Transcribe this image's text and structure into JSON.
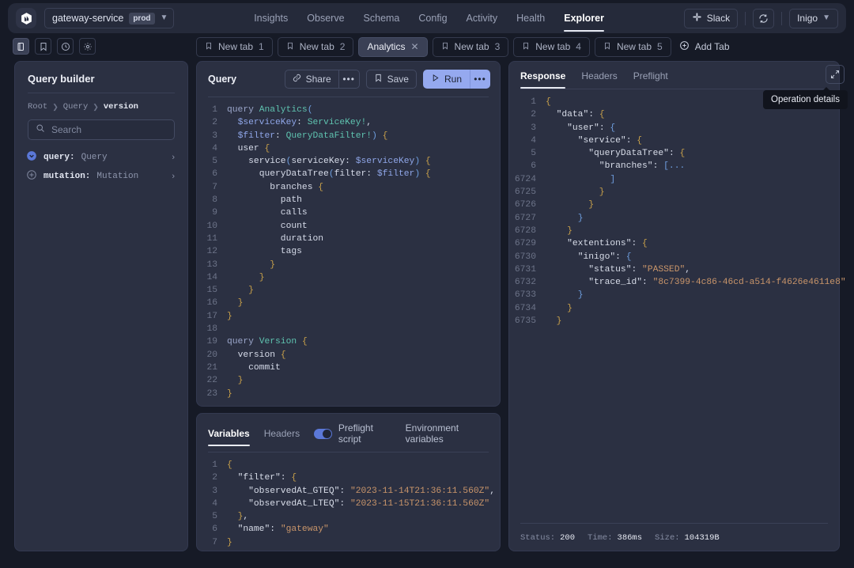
{
  "header": {
    "service_name": "gateway-service",
    "env_badge": "prod",
    "nav": [
      {
        "label": "Insights",
        "active": false
      },
      {
        "label": "Observe",
        "active": false
      },
      {
        "label": "Schema",
        "active": false
      },
      {
        "label": "Config",
        "active": false
      },
      {
        "label": "Activity",
        "active": false
      },
      {
        "label": "Health",
        "active": false
      },
      {
        "label": "Explorer",
        "active": true
      }
    ],
    "slack_label": "Slack",
    "refresh_icon": "refresh-icon",
    "user_menu": "Inigo"
  },
  "rail": [
    {
      "icon": "docs-icon",
      "active": true
    },
    {
      "icon": "bookmark-icon",
      "active": false
    },
    {
      "icon": "history-clock-icon",
      "active": false
    },
    {
      "icon": "gear-icon",
      "active": false
    }
  ],
  "tabs": {
    "items": [
      {
        "label": "New tab",
        "num": "1",
        "active": false,
        "closable": false
      },
      {
        "label": "New tab",
        "num": "2",
        "active": false,
        "closable": false
      },
      {
        "label": "Analytics",
        "num": "",
        "active": true,
        "closable": true
      },
      {
        "label": "New tab",
        "num": "3",
        "active": false,
        "closable": false
      },
      {
        "label": "New tab",
        "num": "4",
        "active": false,
        "closable": false
      },
      {
        "label": "New tab",
        "num": "5",
        "active": false,
        "closable": false
      }
    ],
    "add_label": "Add Tab"
  },
  "query_builder": {
    "title": "Query builder",
    "breadcrumb": [
      "Root",
      "Query",
      "version"
    ],
    "search_placeholder": "Search",
    "search_value": "",
    "tree": [
      {
        "name": "query:",
        "type": "Query",
        "expanded": true
      },
      {
        "name": "mutation:",
        "type": "Mutation",
        "expanded": false
      }
    ]
  },
  "query_editor": {
    "title": "Query",
    "share_label": "Share",
    "save_label": "Save",
    "run_label": "Run",
    "more_label": "•••",
    "lines": [
      {
        "n": "1",
        "html": "<span class='k-kw'>query</span> <span class='k-type'>Analytics</span><span class='k-paren'>(</span>"
      },
      {
        "n": "2",
        "html": "  <span class='k-var'>$serviceKey</span><span class='k-field'>:</span> <span class='k-type'>ServiceKey!</span><span class='k-field'>,</span>"
      },
      {
        "n": "3",
        "html": "  <span class='k-var'>$filter</span><span class='k-field'>:</span> <span class='k-type'>QueryDataFilter!</span><span class='k-paren'>)</span> <span class='k-punc'>{</span>"
      },
      {
        "n": "4",
        "html": "  <span class='k-field'>user</span> <span class='k-punc'>{</span>"
      },
      {
        "n": "5",
        "html": "    <span class='k-field'>service</span><span class='k-paren'>(</span><span class='k-field'>serviceKey:</span> <span class='k-var'>$serviceKey</span><span class='k-paren'>)</span> <span class='k-punc'>{</span>"
      },
      {
        "n": "6",
        "html": "      <span class='k-field'>queryDataTree</span><span class='k-paren'>(</span><span class='k-field'>filter:</span> <span class='k-var'>$filter</span><span class='k-paren'>)</span> <span class='k-punc'>{</span>"
      },
      {
        "n": "7",
        "html": "        <span class='k-field'>branches</span> <span class='k-punc'>{</span>"
      },
      {
        "n": "8",
        "html": "          <span class='k-field'>path</span>"
      },
      {
        "n": "9",
        "html": "          <span class='k-field'>calls</span>"
      },
      {
        "n": "10",
        "html": "          <span class='k-field'>count</span>"
      },
      {
        "n": "11",
        "html": "          <span class='k-field'>duration</span>"
      },
      {
        "n": "12",
        "html": "          <span class='k-field'>tags</span>"
      },
      {
        "n": "13",
        "html": "        <span class='k-punc'>}</span>"
      },
      {
        "n": "14",
        "html": "      <span class='k-punc'>}</span>"
      },
      {
        "n": "15",
        "html": "    <span class='k-punc'>}</span>"
      },
      {
        "n": "16",
        "html": "  <span class='k-punc'>}</span>"
      },
      {
        "n": "17",
        "html": "<span class='k-punc'>}</span>"
      },
      {
        "n": "18",
        "html": ""
      },
      {
        "n": "19",
        "html": "<span class='k-kw'>query</span> <span class='k-type'>Version</span> <span class='k-punc'>{</span>"
      },
      {
        "n": "20",
        "html": "  <span class='k-field'>version</span> <span class='k-punc'>{</span>"
      },
      {
        "n": "21",
        "html": "    <span class='k-field'>commit</span>"
      },
      {
        "n": "22",
        "html": "  <span class='k-punc'>}</span>"
      },
      {
        "n": "23",
        "html": "<span class='k-punc'>}</span>"
      }
    ]
  },
  "variables_panel": {
    "tabs": [
      {
        "label": "Variables",
        "active": true
      },
      {
        "label": "Headers",
        "active": false
      }
    ],
    "preflight_toggle_on": true,
    "preflight_label": "Preflight script",
    "env_vars_label": "Environment variables",
    "lines": [
      {
        "n": "1",
        "html": "<span class='k-punc'>{</span>"
      },
      {
        "n": "2",
        "html": "  <span class='k-prop'>\"filter\"</span><span class='k-field'>:</span> <span class='k-punc'>{</span>"
      },
      {
        "n": "3",
        "html": "    <span class='k-prop'>\"observedAt_GTEQ\"</span><span class='k-field'>:</span> <span class='k-str'>\"2023-11-14T21:36:11.560Z\"</span><span class='k-field'>,</span>"
      },
      {
        "n": "4",
        "html": "    <span class='k-prop'>\"observedAt_LTEQ\"</span><span class='k-field'>:</span> <span class='k-str'>\"2023-11-15T21:36:11.560Z\"</span>"
      },
      {
        "n": "5",
        "html": "  <span class='k-punc'>}</span><span class='k-field'>,</span>"
      },
      {
        "n": "6",
        "html": "  <span class='k-prop'>\"name\"</span><span class='k-field'>:</span> <span class='k-str'>\"gateway\"</span>"
      },
      {
        "n": "7",
        "html": "<span class='k-punc'>}</span>"
      }
    ]
  },
  "response_panel": {
    "tabs": [
      {
        "label": "Response",
        "active": true
      },
      {
        "label": "Headers",
        "active": false
      },
      {
        "label": "Preflight",
        "active": false
      }
    ],
    "expand_icon": "expand-diagonal-icon",
    "tooltip": "Operation details",
    "lines": [
      {
        "n": "1",
        "html": "<span class='k-punc'>{</span>"
      },
      {
        "n": "2",
        "html": "  <span class='k-prop'>\"data\"</span><span class='k-field'>:</span> <span class='k-punc'>{</span>"
      },
      {
        "n": "3",
        "html": "    <span class='k-prop'>\"user\"</span><span class='k-field'>:</span> <span class='k-paren'>{</span>"
      },
      {
        "n": "4",
        "html": "      <span class='k-prop'>\"service\"</span><span class='k-field'>:</span> <span class='k-punc'>{</span>"
      },
      {
        "n": "5",
        "html": "        <span class='k-prop'>\"queryDataTree\"</span><span class='k-field'>:</span> <span class='k-punc'>{</span>"
      },
      {
        "n": "6",
        "html": "          <span class='k-prop'>\"branches\"</span><span class='k-field'>:</span> <span class='k-paren'>[...</span>"
      },
      {
        "n": "6724",
        "html": "            <span class='k-paren'>]</span>"
      },
      {
        "n": "6725",
        "html": "          <span class='k-punc'>}</span>"
      },
      {
        "n": "6726",
        "html": "        <span class='k-punc'>}</span>"
      },
      {
        "n": "6727",
        "html": "      <span class='k-paren'>}</span>"
      },
      {
        "n": "6728",
        "html": "    <span class='k-punc'>}</span>"
      },
      {
        "n": "6729",
        "html": "    <span class='k-prop'>\"extentions\"</span><span class='k-field'>:</span> <span class='k-punc'>{</span>"
      },
      {
        "n": "6730",
        "html": "      <span class='k-prop'>\"inigo\"</span><span class='k-field'>:</span> <span class='k-paren'>{</span>"
      },
      {
        "n": "6731",
        "html": "        <span class='k-prop'>\"status\"</span><span class='k-field'>:</span> <span class='k-str'>\"PASSED\"</span><span class='k-field'>,</span>"
      },
      {
        "n": "6732",
        "html": "        <span class='k-prop'>\"trace_id\"</span><span class='k-field'>:</span> <span class='k-str'>\"8c7399-4c86-46cd-a514-f4626e4611e8\"</span>"
      },
      {
        "n": "6733",
        "html": "      <span class='k-paren'>}</span>"
      },
      {
        "n": "6734",
        "html": "    <span class='k-punc'>}</span>"
      },
      {
        "n": "6735",
        "html": "  <span class='k-punc'>}</span>"
      }
    ],
    "status": {
      "status_label": "Status:",
      "status_value": "200",
      "time_label": "Time:",
      "time_value": "386ms",
      "size_label": "Size:",
      "size_value": "104319B"
    }
  },
  "colors": {
    "accent_blue": "#95a9ef",
    "panel_bg": "#2b3042",
    "page_bg": "#161a26",
    "header_bg": "#252a3a"
  }
}
